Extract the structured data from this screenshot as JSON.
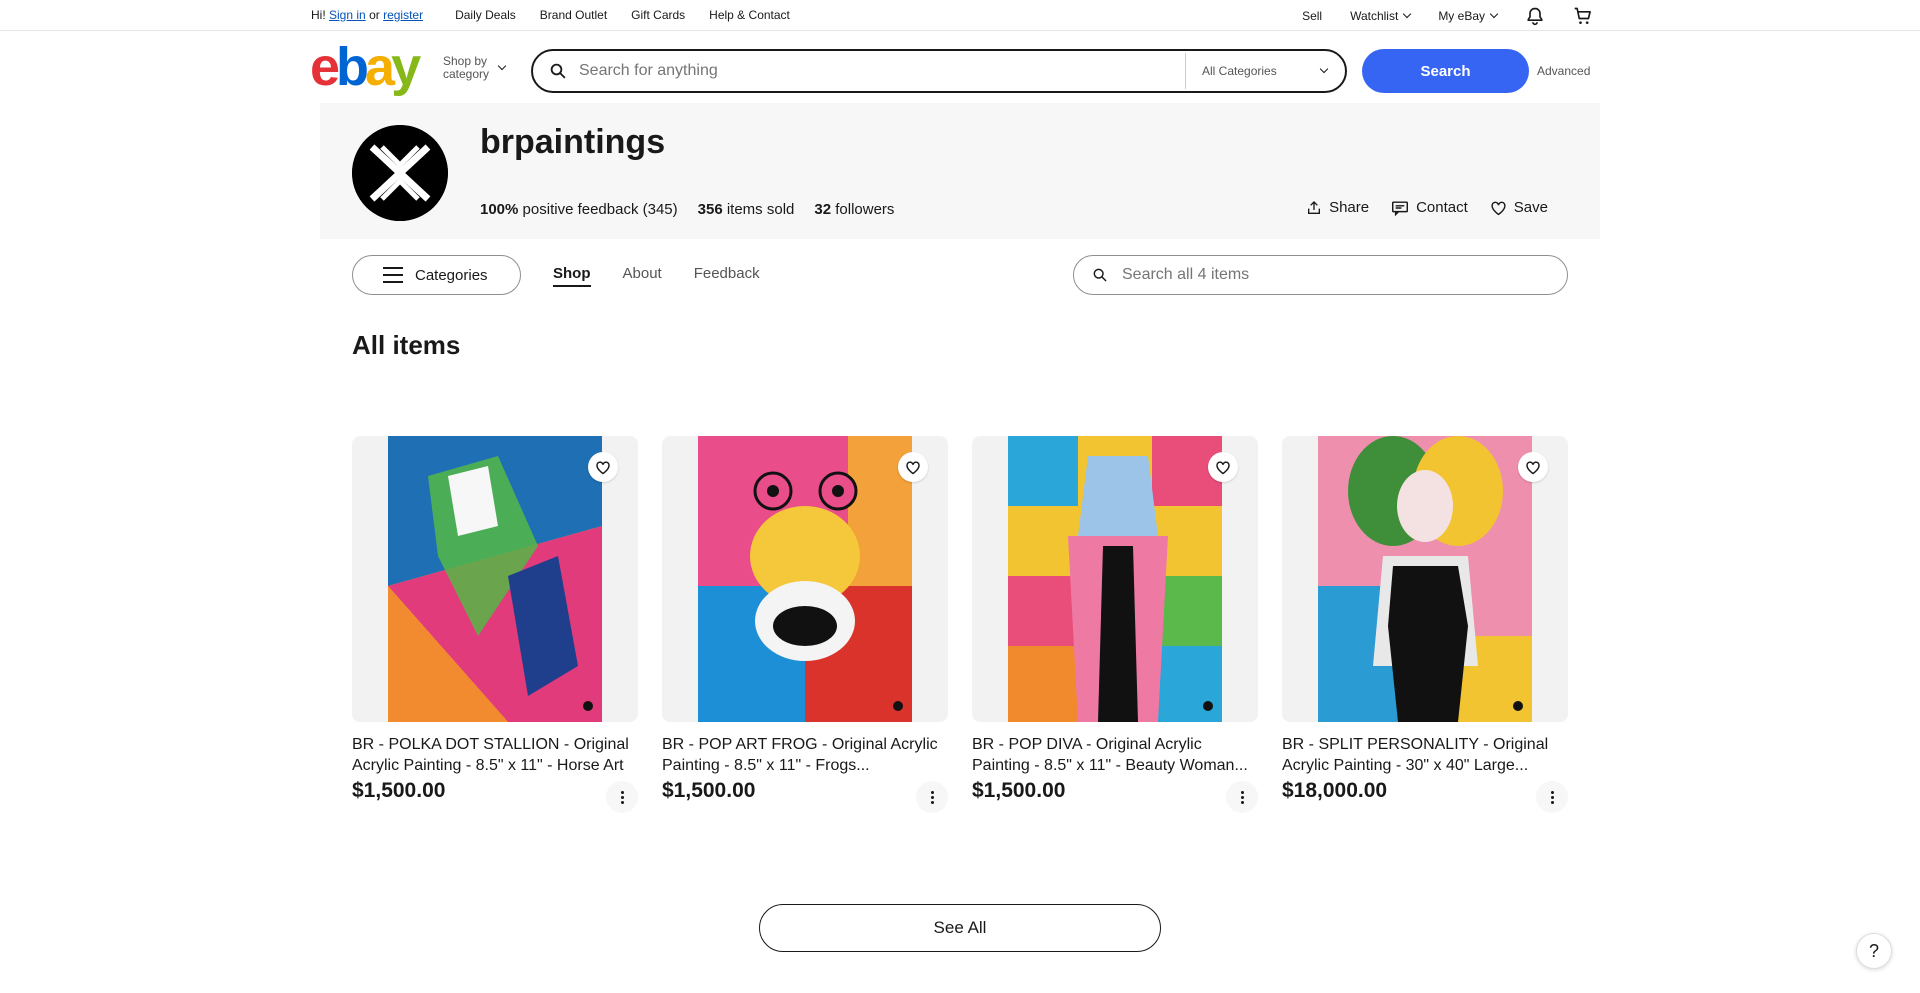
{
  "topbar": {
    "greeting_prefix": "Hi!",
    "sign_in": "Sign in",
    "or": "or",
    "register": "register",
    "links": [
      "Daily Deals",
      "Brand Outlet",
      "Gift Cards",
      "Help & Contact"
    ],
    "sell": "Sell",
    "watchlist": "Watchlist",
    "my_ebay": "My eBay"
  },
  "header": {
    "logo": [
      "e",
      "b",
      "a",
      "y"
    ],
    "shop_by_line1": "Shop by",
    "shop_by_line2": "category",
    "search_placeholder": "Search for anything",
    "category_selected": "All Categories",
    "search_button": "Search",
    "advanced": "Advanced"
  },
  "store": {
    "name": "brpaintings",
    "feedback_pct": "100%",
    "feedback_label": "positive feedback (345)",
    "items_sold_count": "356",
    "items_sold_label": "items sold",
    "followers_count": "32",
    "followers_label": "followers",
    "share": "Share",
    "contact": "Contact",
    "save": "Save"
  },
  "nav": {
    "categories": "Categories",
    "tabs": [
      "Shop",
      "About",
      "Feedback"
    ],
    "active_tab": "Shop",
    "store_search_placeholder": "Search all 4 items"
  },
  "section_title": "All items",
  "items": [
    {
      "title": "BR - POLKA DOT STALLION - Original Acrylic Painting - 8.5\" x 11\" - Horse Art",
      "price": "$1,500.00",
      "colors": [
        "#f0c93a",
        "#e23b7c",
        "#1f6fb5",
        "#55b947",
        "#f28b2f"
      ]
    },
    {
      "title": "BR - POP ART FROG - Original Acrylic Painting - 8.5\" x 11\" - Frogs...",
      "price": "$1,500.00",
      "colors": [
        "#e94d8a",
        "#1d8fd6",
        "#f5c73a",
        "#d9332c",
        "#f3a13a"
      ]
    },
    {
      "title": "BR - POP DIVA - Original Acrylic Painting - 8.5\" x 11\" - Beauty Woman...",
      "price": "$1,500.00",
      "colors": [
        "#f3c431",
        "#2aa6d9",
        "#e94d7a",
        "#f08a2c",
        "#5bb84b"
      ]
    },
    {
      "title": "BR - SPLIT PERSONALITY - Original Acrylic Painting - 30\" x 40\" Large...",
      "price": "$18,000.00",
      "colors": [
        "#ee8fae",
        "#2b9bd4",
        "#f3c431",
        "#111111",
        "#3f8f3a"
      ]
    }
  ],
  "see_all": "See All",
  "help": "?"
}
